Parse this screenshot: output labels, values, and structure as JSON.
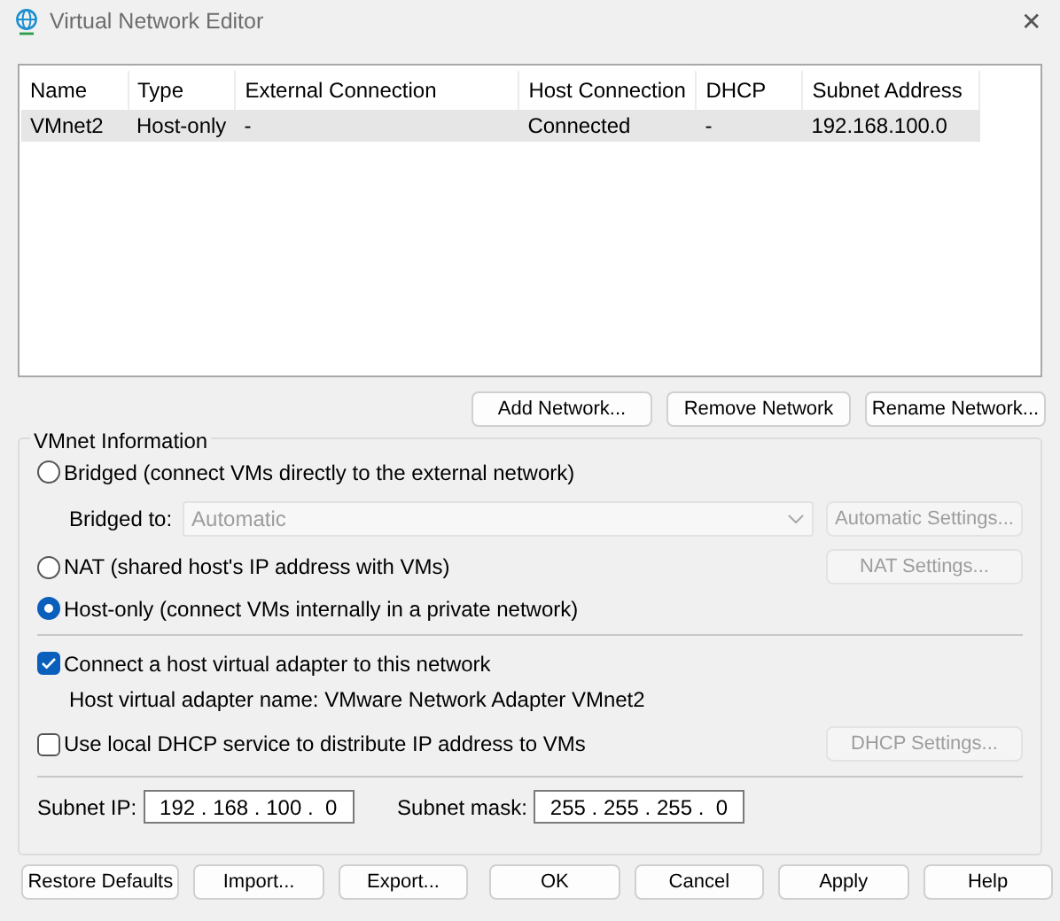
{
  "window": {
    "title": "Virtual Network Editor",
    "close": "✕"
  },
  "table": {
    "columns": [
      "Name",
      "Type",
      "External Connection",
      "Host Connection",
      "DHCP",
      "Subnet Address"
    ],
    "rows": [
      {
        "cells": [
          "VMnet2",
          "Host-only",
          "-",
          "Connected",
          "-",
          "192.168.100.0"
        ],
        "selected": true
      }
    ]
  },
  "network_buttons": [
    {
      "label": "Add Network..."
    },
    {
      "label": "Remove Network"
    },
    {
      "label": "Rename Network..."
    }
  ],
  "vmnet_information": {
    "title": "VMnet Information",
    "bridged": {
      "label": "Bridged (connect VMs directly to the external network)",
      "selected": false
    },
    "bridged_to": {
      "label": "Bridged to:",
      "value": "Automatic",
      "disabled": true
    },
    "automatic_settings_button": {
      "label": "Automatic Settings...",
      "disabled": true
    },
    "nat": {
      "label": "NAT (shared host's IP address with VMs)",
      "selected": false
    },
    "nat_settings_button": {
      "label": "NAT Settings...",
      "disabled": true
    },
    "host_only": {
      "label": "Host-only (connect VMs internally in a private network)",
      "selected": true
    },
    "host_adapter": {
      "label": "Connect a host virtual adapter to this network",
      "checked": true
    },
    "adapter_name": "Host virtual adapter name: VMware Network Adapter VMnet2",
    "dhcp": {
      "label": "Use local DHCP service to distribute IP address to VMs",
      "checked": false
    },
    "dhcp_settings_button": {
      "label": "DHCP Settings...",
      "disabled": true
    },
    "subnet_ip": {
      "label": "Subnet IP:",
      "value": "192 . 168 . 100 .  0"
    },
    "subnet_mask": {
      "label": "Subnet mask:",
      "value": "255 . 255 . 255 .  0"
    }
  },
  "buttons": [
    {
      "label": "Restore Defaults"
    },
    {
      "label": "Import..."
    },
    {
      "label": "Export..."
    },
    {
      "label": "OK"
    },
    {
      "label": "Cancel"
    },
    {
      "label": "Apply"
    },
    {
      "label": "Help"
    }
  ]
}
